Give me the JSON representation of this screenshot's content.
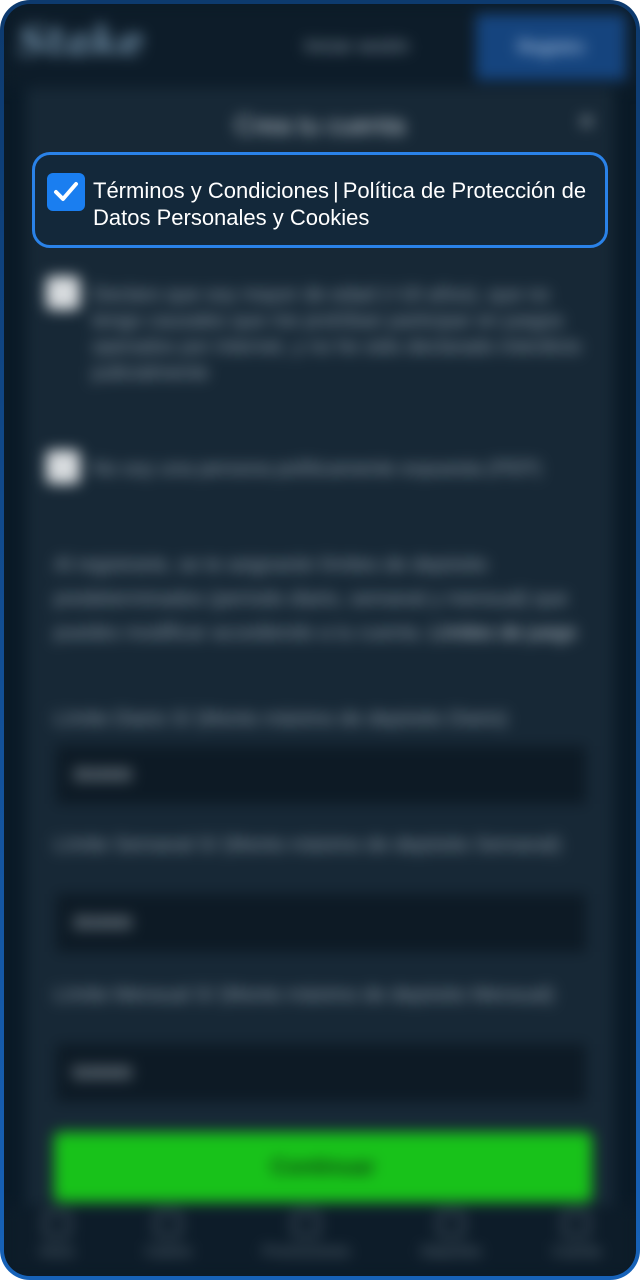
{
  "header": {
    "logo_text": "Stake",
    "login_label": "Iniciar sesión",
    "register_label": "Registro"
  },
  "modal": {
    "title": "Crea tu cuenta",
    "close_glyph": "×",
    "terms": {
      "checked": true,
      "terms_link": "Términos y Condiciones",
      "separator": "|",
      "privacy_link": "Política de Protección de Datos Personales y Cookies"
    },
    "age_declaration": "Declaro que soy mayor de edad (+18 años), que no tengo causales que me prohíban participar en juegos operados por internet, y no he sido declarado interdicto judicialmente",
    "pep_declaration": "No soy una persona políticamente expuesta (PEP)",
    "limits_info": "Al registrarte, se te asignarán límites de depósito predeterminados (período diario, semanal y mensual) que puedes modificar accediendo a tu cuenta.",
    "limits_link": "Límites de juego",
    "daily_label": "Límite Diario S/ (Monto máximo de depósito Diario)",
    "daily_value": "350000",
    "weekly_label": "Límite Semanal S/ (Monto máximo de depósito Semanal)",
    "weekly_value": "350000",
    "monthly_label": "Límite Mensual S/ (Monto máximo de depósito Mensual)",
    "monthly_value": "500000",
    "continue_label": "Continuar"
  },
  "bottom_nav": [
    {
      "label": "Inicio"
    },
    {
      "label": "Casino"
    },
    {
      "label": "Promociones"
    },
    {
      "label": "Deportes"
    },
    {
      "label": "Cuenta"
    }
  ],
  "colors": {
    "accent_blue": "#2a82e8",
    "checkbox_blue": "#1a7ef0",
    "continue_green": "#18c21a"
  }
}
